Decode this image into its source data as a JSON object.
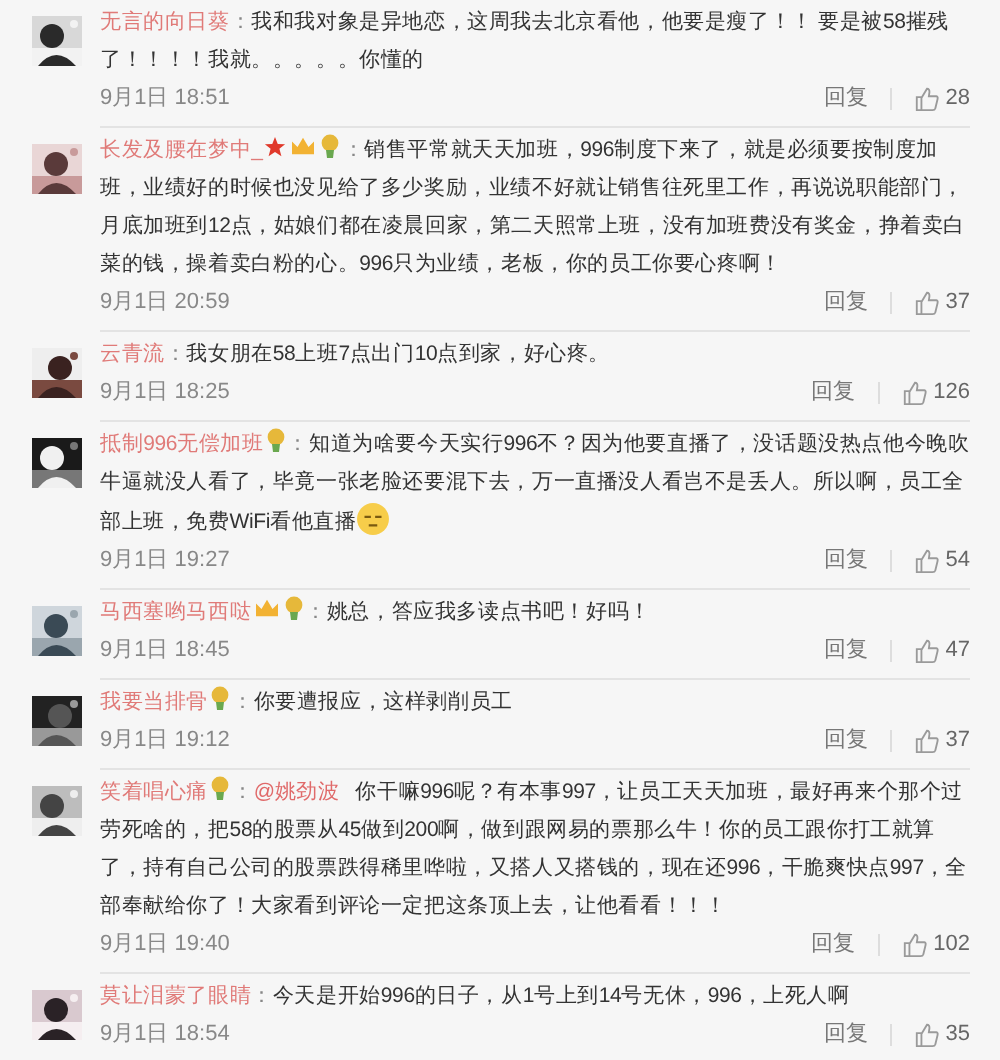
{
  "comments": [
    {
      "name": "无言的向日葵",
      "colon": "：",
      "text": "我和我对象是异地恋，这周我去北京看他，他要是瘦了！！ 要是被58摧残了！！！！我就。。。。。你懂的",
      "trailing_emoji": false,
      "time": "9月1日 18:51",
      "reply": "回复",
      "likes": "28",
      "avatar": {
        "kind": "picture"
      }
    },
    {
      "name": "长发及腰在梦中_",
      "badges": [
        {
          "kind": "star"
        },
        {
          "kind": "crown"
        },
        {
          "kind": "bulb"
        }
      ],
      "colon": "：",
      "text": "销售平常就天天加班，996制度下来了，就是必须要按制度加班，业绩好的时候也没见给了多少奖励，业绩不好就让销售往死里工作，再说说职能部门，月底加班到12点，姑娘们都在凌晨回家，第二天照常上班，没有加班费没有奖金，挣着卖白菜的钱，操着卖白粉的心。996只为业绩，老板，你的员工你要心疼啊！",
      "trailing_emoji": false,
      "time": "9月1日 20:59",
      "reply": "回复",
      "likes": "37",
      "avatar": {
        "kind": "picture"
      }
    },
    {
      "name": "云青流",
      "colon": "：",
      "text": "我女朋在58上班7点出门10点到家，好心疼。",
      "trailing_emoji": false,
      "time": "9月1日 18:25",
      "reply": "回复",
      "likes": "126",
      "avatar": {
        "kind": "picture"
      }
    },
    {
      "name": "抵制996无偿加班",
      "badges": [
        {
          "kind": "bulb"
        }
      ],
      "colon": "：",
      "text": "知道为啥要今天实行996不？因为他要直播了，没话题没热点他今晚吹牛逼就没人看了，毕竟一张老脸还要混下去，万一直播没人看岂不是丢人。所以啊，员工全部上班，免费WiFi看他直播",
      "trailing_emoji": true,
      "time": "9月1日 19:27",
      "reply": "回复",
      "likes": "54",
      "avatar": {
        "kind": "picture"
      }
    },
    {
      "name": "马西塞哟马西哒",
      "badges": [
        {
          "kind": "crown"
        },
        {
          "kind": "bulb"
        }
      ],
      "colon": "：",
      "text": "姚总，答应我多读点书吧！好吗！",
      "trailing_emoji": false,
      "time": "9月1日 18:45",
      "reply": "回复",
      "likes": "47",
      "avatar": {
        "kind": "picture"
      }
    },
    {
      "name": "我要当排骨",
      "badges": [
        {
          "kind": "bulb"
        }
      ],
      "colon": "：",
      "text": "你要遭报应，这样剥削员工",
      "trailing_emoji": false,
      "time": "9月1日 19:12",
      "reply": "回复",
      "likes": "37",
      "avatar": {
        "kind": "picture"
      }
    },
    {
      "name": "笑着唱心痛",
      "badges": [
        {
          "kind": "bulb"
        }
      ],
      "colon": "：",
      "mention": "@姚劲波",
      "text": "你干嘛996呢？有本事997，让员工天天加班，最好再来个那个过劳死啥的，把58的股票从45做到200啊，做到跟网易的票那么牛！你的员工跟你打工就算了，持有自己公司的股票跌得稀里哗啦，又搭人又搭钱的，现在还996，干脆爽快点997，全部奉献给你了！大家看到评论一定把这条顶上去，让他看看！！！",
      "trailing_emoji": false,
      "time": "9月1日 19:40",
      "reply": "回复",
      "likes": "102",
      "avatar": {
        "kind": "picture"
      }
    },
    {
      "name": "莫让泪蒙了眼睛",
      "colon": "：",
      "text": "今天是开始996的日子，从1号上到14号无休，996，上死人啊",
      "trailing_emoji": false,
      "time": "9月1日 18:54",
      "reply": "回复",
      "likes": "35",
      "avatar": {
        "kind": "picture"
      }
    }
  ]
}
